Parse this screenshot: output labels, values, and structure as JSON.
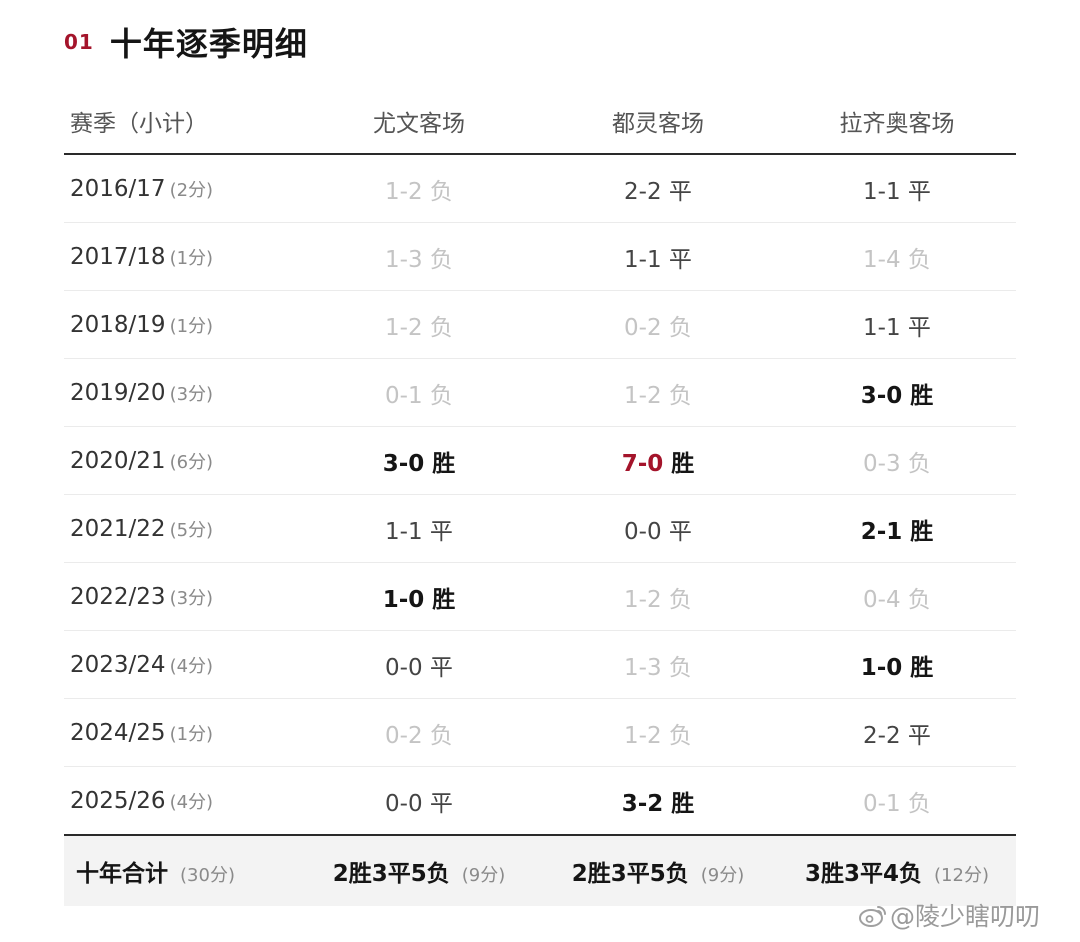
{
  "section": {
    "number": "01",
    "title": "十年逐季明细"
  },
  "columns": [
    "赛季（小计）",
    "尤文客场",
    "都灵客场",
    "拉齐奥客场"
  ],
  "rows": [
    {
      "season": "2016/17",
      "points": "(2分)",
      "results": [
        {
          "text": "1-2 负",
          "outcome": "loss"
        },
        {
          "text": "2-2 平",
          "outcome": "draw"
        },
        {
          "text": "1-1 平",
          "outcome": "draw"
        }
      ]
    },
    {
      "season": "2017/18",
      "points": "(1分)",
      "results": [
        {
          "text": "1-3 负",
          "outcome": "loss"
        },
        {
          "text": "1-1 平",
          "outcome": "draw"
        },
        {
          "text": "1-4 负",
          "outcome": "loss"
        }
      ]
    },
    {
      "season": "2018/19",
      "points": "(1分)",
      "results": [
        {
          "text": "1-2 负",
          "outcome": "loss"
        },
        {
          "text": "0-2 负",
          "outcome": "loss"
        },
        {
          "text": "1-1 平",
          "outcome": "draw"
        }
      ]
    },
    {
      "season": "2019/20",
      "points": "(3分)",
      "results": [
        {
          "text": "0-1 负",
          "outcome": "loss"
        },
        {
          "text": "1-2 负",
          "outcome": "loss"
        },
        {
          "text": "3-0 胜",
          "outcome": "win"
        }
      ]
    },
    {
      "season": "2020/21",
      "points": "(6分)",
      "results": [
        {
          "text": "3-0 胜",
          "outcome": "win"
        },
        {
          "score": "7-0",
          "label": "胜",
          "outcome": "win",
          "highlight": "#a4142b"
        },
        {
          "text": "0-3 负",
          "outcome": "loss"
        }
      ]
    },
    {
      "season": "2021/22",
      "points": "(5分)",
      "results": [
        {
          "text": "1-1 平",
          "outcome": "draw"
        },
        {
          "text": "0-0 平",
          "outcome": "draw"
        },
        {
          "text": "2-1 胜",
          "outcome": "win"
        }
      ]
    },
    {
      "season": "2022/23",
      "points": "(3分)",
      "results": [
        {
          "text": "1-0 胜",
          "outcome": "win"
        },
        {
          "text": "1-2 负",
          "outcome": "loss"
        },
        {
          "text": "0-4 负",
          "outcome": "loss"
        }
      ]
    },
    {
      "season": "2023/24",
      "points": "(4分)",
      "results": [
        {
          "text": "0-0 平",
          "outcome": "draw"
        },
        {
          "text": "1-3 负",
          "outcome": "loss"
        },
        {
          "text": "1-0 胜",
          "outcome": "win"
        }
      ]
    },
    {
      "season": "2024/25",
      "points": "(1分)",
      "results": [
        {
          "text": "0-2 负",
          "outcome": "loss"
        },
        {
          "text": "1-2 负",
          "outcome": "loss"
        },
        {
          "text": "2-2 平",
          "outcome": "draw"
        }
      ]
    },
    {
      "season": "2025/26",
      "points": "(4分)",
      "results": [
        {
          "text": "0-0 平",
          "outcome": "draw"
        },
        {
          "text": "3-2 胜",
          "outcome": "win"
        },
        {
          "text": "0-1 负",
          "outcome": "loss"
        }
      ]
    }
  ],
  "total": {
    "label": "十年合计",
    "points": "(30分)",
    "cells": [
      {
        "text": "2胜3平5负",
        "points": "(9分)"
      },
      {
        "text": "2胜3平5负",
        "points": "(9分)"
      },
      {
        "text": "3胜3平4负",
        "points": "(12分)"
      }
    ]
  },
  "watermark": {
    "text": "@陵少瞎叨叨",
    "icon": "weibo-icon"
  },
  "colors": {
    "accent": "#a4142b",
    "loss": "#c4c4c4",
    "win": "#151515"
  }
}
